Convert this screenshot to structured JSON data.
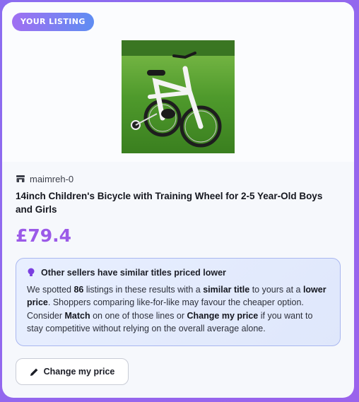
{
  "listing": {
    "badge": "YOUR LISTING",
    "seller": "maimreh-0",
    "title": "14inch Children's Bicycle with Training Wheel for 2-5 Year-Old Boys and Girls",
    "price": "£79.4"
  },
  "notice": {
    "icon": "lightbulb-icon",
    "heading": "Other sellers have similar titles priced lower",
    "body": {
      "t1": "We spotted ",
      "count": "86",
      "t2": " listings in these results with a ",
      "similar_title": "similar title",
      "t3": " to yours at a ",
      "lower_price": "lower price",
      "t4": ". Shoppers comparing like-for-like may favour the cheaper option. Consider ",
      "match": "Match",
      "t5": " on one of those lines or ",
      "change_my_price": "Change my price",
      "t6": " if you want to stay competitive without relying on the overall average alone."
    }
  },
  "actions": {
    "change_price_label": "Change my price",
    "change_price_icon": "pencil-icon"
  },
  "colors": {
    "accent_price": "#9b5ae8",
    "badge_start": "#a06ff2",
    "badge_end": "#5f8df2",
    "notice_border": "#a9b7f0"
  }
}
